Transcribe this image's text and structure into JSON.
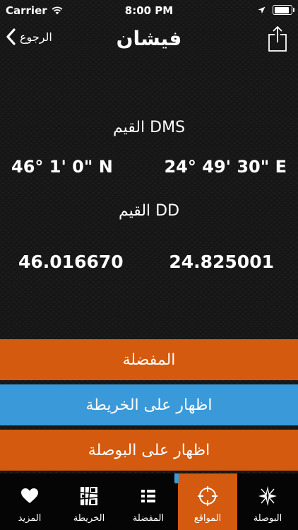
{
  "status_bar": {
    "carrier": "Carrier",
    "time": "8:00 PM",
    "battery_level": 0.9
  },
  "nav": {
    "back_label": "الرجوع",
    "title": "فيشان"
  },
  "dms": {
    "heading": "القيم DMS",
    "latitude": "46°  1' 0\" N",
    "longitude": "24°  49' 30\" E"
  },
  "dd": {
    "heading": "القيم DD",
    "latitude": "46.016670",
    "longitude": "24.825001"
  },
  "actions": {
    "favorites": "المفضلة",
    "show_on_map": "اظهار على الخريطة",
    "show_on_compass": "اظهار   على البوصلة"
  },
  "tabs": [
    {
      "label": "المزيد",
      "icon": "heart-icon"
    },
    {
      "label": "الخريطة",
      "icon": "map-icon"
    },
    {
      "label": "المفضلة",
      "icon": "list-icon"
    },
    {
      "label": "المواقع",
      "icon": "crosshair-icon",
      "active": true
    },
    {
      "label": "البوصلة",
      "icon": "compass-icon"
    }
  ],
  "colors": {
    "accent_orange": "#d45a0f",
    "accent_blue": "#3a9ad9",
    "tab_bar": "#050505"
  }
}
